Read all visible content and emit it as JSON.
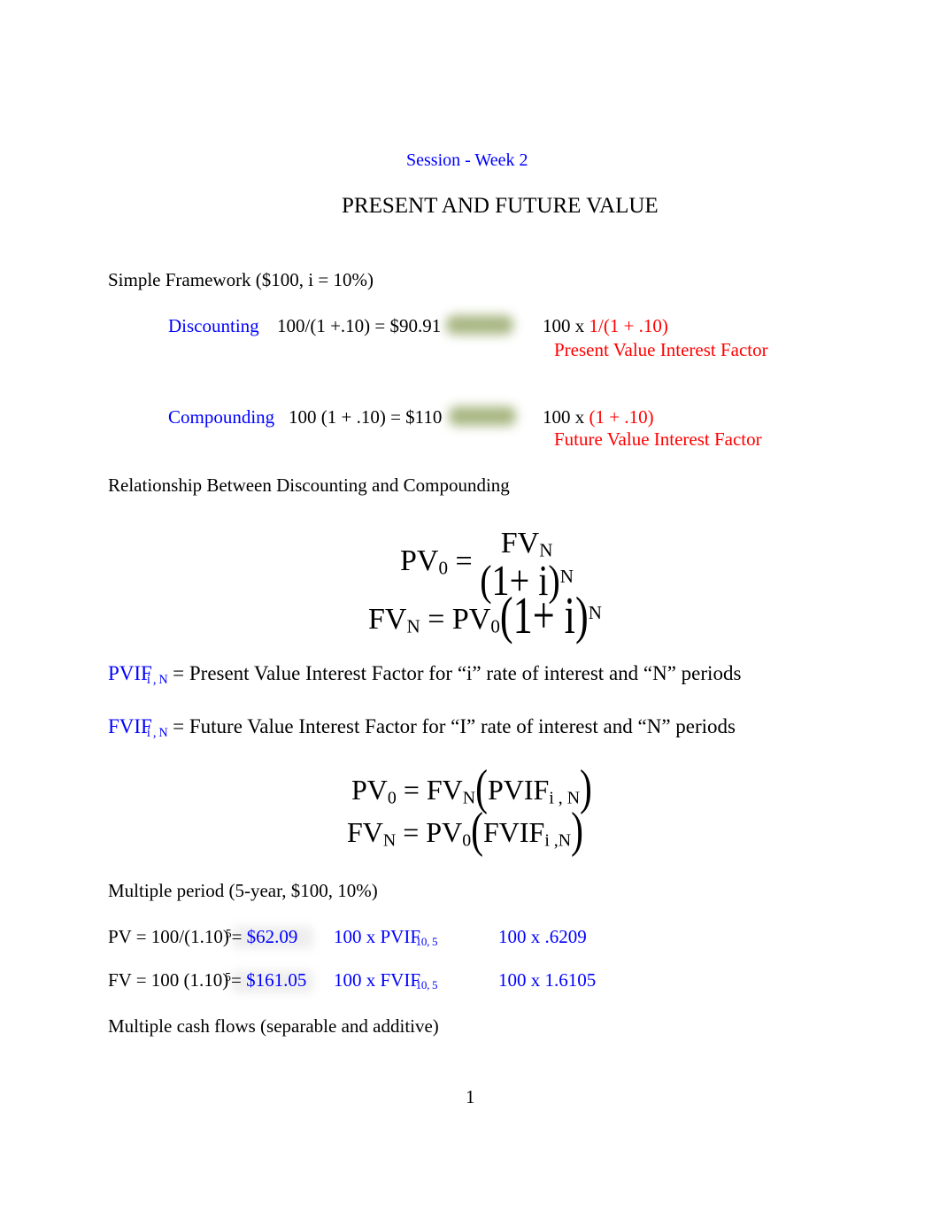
{
  "document": {
    "session_header": "Session - Week 2",
    "title": "PRESENT AND FUTURE VALUE",
    "page_number": "1"
  },
  "colors": {
    "heading_blue": "#0000ff",
    "accent_red": "#ff0000",
    "body_black": "#000000",
    "redaction_green": "#9aab6e"
  },
  "simple_framework": {
    "heading": "Simple Framework ($100, i = 10%)",
    "rows": [
      {
        "label": "Discounting",
        "equation": "100/(1 +.10) = $90.91",
        "factor_prefix": "100 x ",
        "factor_expression": "1/(1 + .10)",
        "factor_name": "Present Value Interest Factor"
      },
      {
        "label": "Compounding",
        "equation": "100 (1 + .10) = $110",
        "factor_prefix": "100 x ",
        "factor_expression": "(1 + .10)",
        "factor_name": "Future Value Interest Factor"
      }
    ]
  },
  "relationship": {
    "heading": "Relationship Between Discounting and Compounding",
    "equation_pv": {
      "lhs_base": "PV",
      "lhs_sub": "0",
      "equals": "=",
      "numerator_base": "FV",
      "numerator_sub": "N",
      "denominator": "(1+ i)",
      "denominator_exp": "N"
    },
    "equation_fv": {
      "lhs_base": "FV",
      "lhs_sub": "N",
      "equals": "=",
      "rhs_base": "PV",
      "rhs_sub": "0",
      "rhs_paren": "(1+ i)",
      "rhs_exp": "N"
    }
  },
  "definitions": [
    {
      "symbol_base": "PVIF",
      "symbol_sub": "i , N",
      "text": "= Present Value Interest Factor for “i” rate of interest and “N” periods"
    },
    {
      "symbol_base": "FVIF",
      "symbol_sub": "i , N",
      "text": "= Future Value Interest Factor for “I” rate of interest and “N” periods"
    }
  ],
  "factor_equations": {
    "line1": {
      "lhs_base": "PV",
      "lhs_sub": "0",
      "equals": "=",
      "rhs_base": "FV",
      "rhs_sub": "N",
      "paren_open": "(",
      "factor_base": "PVIF",
      "factor_sub": "i , N",
      "paren_close": ")"
    },
    "line2": {
      "lhs_base": "FV",
      "lhs_sub": "N",
      "equals": "=",
      "rhs_base": "PV",
      "rhs_sub": "0",
      "paren_open": "(",
      "factor_base": "FVIF",
      "factor_sub": "i ,N",
      "paren_close": ")"
    }
  },
  "multiple_period": {
    "heading": "Multiple period (5-year, $100, 10%)",
    "rows": [
      {
        "expr_prefix": "PV = 100/(1.10)",
        "expr_exp": "5",
        "expr_equals": "=",
        "value": "$62.09",
        "factor_prefix": "100 x PVIF",
        "factor_sub": "10, 5",
        "product": "100 x .6209"
      },
      {
        "expr_prefix": "FV = 100 (1.10)",
        "expr_exp": "5",
        "expr_equals": "=",
        "value": "$161.05",
        "factor_prefix": "100 x FVIF",
        "factor_sub": "10, 5",
        "product": "100 x 1.6105"
      }
    ]
  },
  "footer_note": "Multiple cash flows (separable and additive)"
}
